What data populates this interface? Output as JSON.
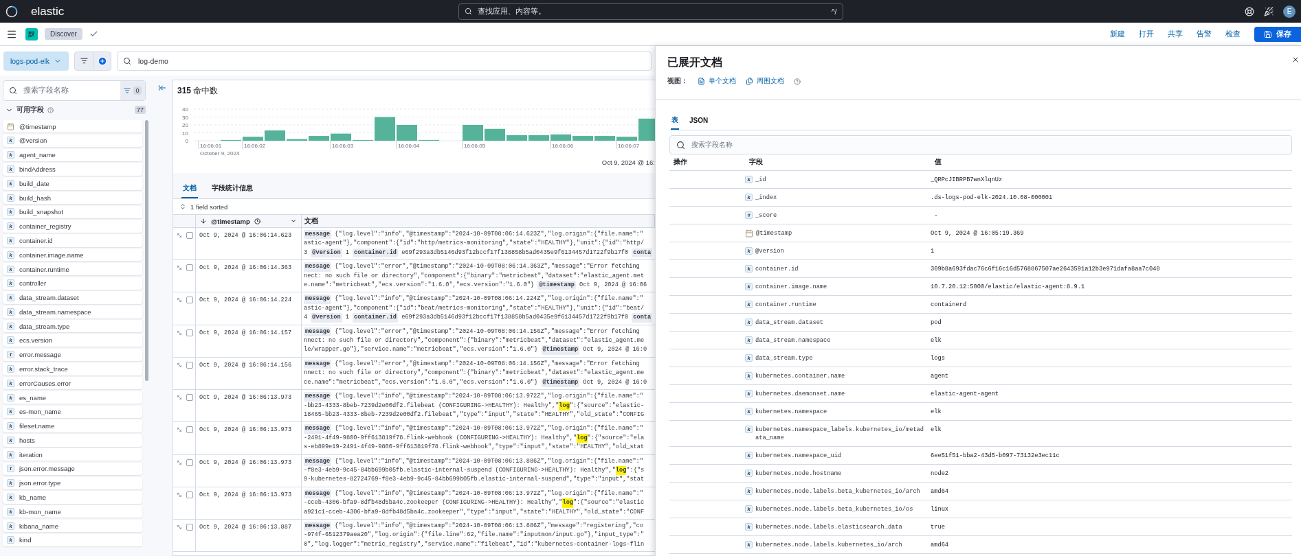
{
  "top_bar": {
    "brand": "elastic",
    "search": {
      "placeholder": "查找应用、内容等。",
      "shortcut": "^/"
    },
    "avatar": "E"
  },
  "nav_bar": {
    "space_badge": "默",
    "breadcrumb": "Discover",
    "actions": [
      "新建",
      "打开",
      "共享",
      "告警",
      "检查"
    ],
    "save": "保存"
  },
  "query_bar": {
    "data_view": "logs-pod-elk",
    "query": "log-demo"
  },
  "sidebar": {
    "search": {
      "placeholder": "搜索字段名称"
    },
    "filter_count": "0",
    "section": {
      "title": "可用字段",
      "count": "77",
      "expanded": true
    },
    "fields": [
      {
        "name": "@timestamp",
        "kind": "date"
      },
      {
        "name": "@version",
        "kind": "keyword",
        "badge": "k"
      },
      {
        "name": "agent_name",
        "kind": "keyword",
        "badge": "k"
      },
      {
        "name": "bindAddress",
        "kind": "keyword",
        "badge": "k"
      },
      {
        "name": "build_date",
        "kind": "keyword",
        "badge": "k"
      },
      {
        "name": "build_hash",
        "kind": "keyword",
        "badge": "k"
      },
      {
        "name": "build_snapshot",
        "kind": "keyword",
        "badge": "k"
      },
      {
        "name": "container_registry",
        "kind": "keyword",
        "badge": "k"
      },
      {
        "name": "container.id",
        "kind": "keyword",
        "badge": "k"
      },
      {
        "name": "container.image.name",
        "kind": "keyword",
        "badge": "k"
      },
      {
        "name": "container.runtime",
        "kind": "keyword",
        "badge": "k"
      },
      {
        "name": "controller",
        "kind": "keyword",
        "badge": "k"
      },
      {
        "name": "data_stream.dataset",
        "kind": "keyword",
        "badge": "k"
      },
      {
        "name": "data_stream.namespace",
        "kind": "keyword",
        "badge": "k"
      },
      {
        "name": "data_stream.type",
        "kind": "keyword",
        "badge": "k"
      },
      {
        "name": "ecs.version",
        "kind": "keyword",
        "badge": "k"
      },
      {
        "name": "error.message",
        "kind": "text",
        "badge": "t"
      },
      {
        "name": "error.stack_trace",
        "kind": "keyword",
        "badge": "k"
      },
      {
        "name": "errorCauses.error",
        "kind": "keyword",
        "badge": "k"
      },
      {
        "name": "es_name",
        "kind": "keyword",
        "badge": "k"
      },
      {
        "name": "es-mon_name",
        "kind": "keyword",
        "badge": "k"
      },
      {
        "name": "fileset.name",
        "kind": "keyword",
        "badge": "k"
      },
      {
        "name": "hosts",
        "kind": "keyword",
        "badge": "k"
      },
      {
        "name": "iteration",
        "kind": "keyword",
        "badge": "k"
      },
      {
        "name": "json.error.message",
        "kind": "text",
        "badge": "t"
      },
      {
        "name": "json.error.type",
        "kind": "keyword",
        "badge": "k"
      },
      {
        "name": "kb_name",
        "kind": "keyword",
        "badge": "k"
      },
      {
        "name": "kb-mon_name",
        "kind": "keyword",
        "badge": "k"
      },
      {
        "name": "kibana_name",
        "kind": "keyword",
        "badge": "k"
      },
      {
        "name": "kind",
        "kind": "keyword",
        "badge": "k"
      }
    ]
  },
  "hits": {
    "title": "**315** 命中数"
  },
  "histogram": {
    "time_range": "Oct 9, 2024 @ 16:",
    "chart_data": {
      "type": "bar",
      "xlabel": "October 9, 2024",
      "grid": true,
      "categories": [
        "16:06:01",
        null,
        "16:06:02",
        null,
        null,
        null,
        "16:06:03",
        null,
        null,
        "16:06:04",
        null,
        null,
        "16:06:05",
        null,
        null,
        null,
        "16:06:06",
        null,
        null,
        "16:06:07",
        null
      ],
      "values": [
        0,
        1,
        5,
        13,
        2,
        6,
        9,
        1,
        30,
        20,
        1,
        0,
        20,
        15,
        7,
        7,
        8,
        6,
        6,
        5,
        28
      ],
      "ylim": [
        0,
        40
      ],
      "yticks": [
        0,
        10,
        20,
        30,
        40
      ]
    }
  },
  "tabs": [
    {
      "label": "文档",
      "selected": true
    },
    {
      "label": "字段统计信息",
      "selected": false
    }
  ],
  "sort_info": "1 field sorted",
  "table": {
    "columns": [
      "@timestamp",
      "文档"
    ],
    "rows": [
      {
        "timestamp": "Oct 9, 2024 @ 16:06:14.623",
        "checked": false,
        "lines": [
          [
            {
              "kind": "chip",
              "text": "message"
            },
            {
              "kind": "text",
              "text": " {\"log.level\":\"info\",\"@timestamp\":\"2024-10-09T08:06:14.623Z\",\"log.origin\":{\"file.name\":\""
            }
          ],
          [
            {
              "kind": "text",
              "text": "astic-agent\"},\"component\":{\"id\":\"http/metrics-monitoring\",\"state\":\"HEALTHY\"},\"unit\":{\"id\":\"http/"
            }
          ],
          [
            {
              "kind": "text",
              "text": "3 "
            },
            {
              "kind": "chip",
              "text": "@version"
            },
            {
              "kind": "text",
              "text": " 1 "
            },
            {
              "kind": "chip",
              "text": "container.id"
            },
            {
              "kind": "text",
              "text": " e69f293a3db5146d93f12bccf17f138858b5ad0435e9f6134457d1722f9b17f0 "
            },
            {
              "kind": "chip",
              "text": "conta"
            }
          ]
        ]
      },
      {
        "timestamp": "Oct 9, 2024 @ 16:06:14.363",
        "checked": false,
        "lines": [
          [
            {
              "kind": "chip",
              "text": "message"
            },
            {
              "kind": "text",
              "text": " {\"log.level\":\"error\",\"@timestamp\":\"2024-10-09T08:06:14.363Z\",\"message\":\"Error fetching"
            }
          ],
          [
            {
              "kind": "text",
              "text": "nect: no such file or directory\",\"component\":{\"binary\":\"metricbeat\",\"dataset\":\"elastic_agent.met"
            }
          ],
          [
            {
              "kind": "text",
              "text": "e.name\":\"metricbeat\",\"ecs.version\":\"1.6.0\",\"ecs.version\":\"1.6.0\"} "
            },
            {
              "kind": "chip",
              "text": "@timestamp"
            },
            {
              "kind": "text",
              "text": " Oct 9, 2024 @ 16:06"
            }
          ]
        ]
      },
      {
        "timestamp": "Oct 9, 2024 @ 16:06:14.224",
        "checked": false,
        "lines": [
          [
            {
              "kind": "chip",
              "text": "message"
            },
            {
              "kind": "text",
              "text": " {\"log.level\":\"info\",\"@timestamp\":\"2024-10-09T08:06:14.224Z\",\"log.origin\":{\"file.name\":\""
            }
          ],
          [
            {
              "kind": "text",
              "text": "astic-agent\"},\"component\":{\"id\":\"beat/metrics-monitoring\",\"state\":\"HEALTHY\"},\"unit\":{\"id\":\"beat/"
            }
          ],
          [
            {
              "kind": "text",
              "text": "4 "
            },
            {
              "kind": "chip",
              "text": "@version"
            },
            {
              "kind": "text",
              "text": " 1 "
            },
            {
              "kind": "chip",
              "text": "container.id"
            },
            {
              "kind": "text",
              "text": " e69f293a3db5146d93f12bccf17f138858b5ad0435e9f6134457d1722f9b17f0 "
            },
            {
              "kind": "chip",
              "text": "conta"
            }
          ]
        ]
      },
      {
        "timestamp": "Oct 9, 2024 @ 16:06:14.157",
        "checked": false,
        "lines": [
          [
            {
              "kind": "chip",
              "text": "message"
            },
            {
              "kind": "text",
              "text": " {\"log.level\":\"error\",\"@timestamp\":\"2024-10-09T08:06:14.156Z\",\"message\":\"Error fetching"
            }
          ],
          [
            {
              "kind": "text",
              "text": "nnect: no such file or directory\",\"component\":{\"binary\":\"metricbeat\",\"dataset\":\"elastic_agent.me"
            }
          ],
          [
            {
              "kind": "text",
              "text": "le/wrapper.go\"},\"service.name\":\"metricbeat\",\"ecs.version\":\"1.6.0\"} "
            },
            {
              "kind": "chip",
              "text": "@timestamp"
            },
            {
              "kind": "text",
              "text": " Oct 9, 2024 @ 16:0"
            }
          ]
        ]
      },
      {
        "timestamp": "Oct 9, 2024 @ 16:06:14.156",
        "checked": false,
        "lines": [
          [
            {
              "kind": "chip",
              "text": "message"
            },
            {
              "kind": "text",
              "text": " {\"log.level\":\"error\",\"@timestamp\":\"2024-10-09T08:06:14.156Z\",\"message\":\"Error fetching"
            }
          ],
          [
            {
              "kind": "text",
              "text": "nnect: no such file or directory\",\"component\":{\"binary\":\"metricbeat\",\"dataset\":\"elastic_agent.me"
            }
          ],
          [
            {
              "kind": "text",
              "text": "ce.name\":\"metricbeat\",\"ecs.version\":\"1.6.0\",\"ecs.version\":\"1.6.0\"} "
            },
            {
              "kind": "chip",
              "text": "@timestamp"
            },
            {
              "kind": "text",
              "text": " Oct 9, 2024 @ 16:0"
            }
          ]
        ]
      },
      {
        "timestamp": "Oct 9, 2024 @ 16:06:13.973",
        "checked": false,
        "lines": [
          [
            {
              "kind": "chip",
              "text": "message"
            },
            {
              "kind": "text",
              "text": " {\"log.level\":\"info\",\"@timestamp\":\"2024-10-09T08:06:13.972Z\",\"log.origin\":{\"file.name\":\""
            }
          ],
          [
            {
              "kind": "text",
              "text": "-bb23-4333-8beb-7239d2e00df2.filebeat (CONFIGURING->HEALTHY): Healthy\",\""
            },
            {
              "kind": "mark",
              "text": "log"
            },
            {
              "kind": "text",
              "text": "\":{\"source\":\"elastic-"
            }
          ],
          [
            {
              "kind": "text",
              "text": "18465-bb23-4333-8beb-7239d2e00df2.filebeat\",\"type\":\"input\",\"state\":\"HEALTHY\",\"old_state\":\"CONFIG"
            }
          ]
        ]
      },
      {
        "timestamp": "Oct 9, 2024 @ 16:06:13.973",
        "checked": false,
        "lines": [
          [
            {
              "kind": "chip",
              "text": "message"
            },
            {
              "kind": "text",
              "text": " {\"log.level\":\"info\",\"@timestamp\":\"2024-10-09T08:06:13.972Z\",\"log.origin\":{\"file.name\":\""
            }
          ],
          [
            {
              "kind": "text",
              "text": "-2491-4f49-9800-9ff613819f78.flink-webhook (CONFIGURING->HEALTHY): Healthy\",\""
            },
            {
              "kind": "mark",
              "text": "log"
            },
            {
              "kind": "text",
              "text": "\":{\"source\":\"ela"
            }
          ],
          [
            {
              "kind": "text",
              "text": "s-eb899e19-2491-4f49-9800-9ff613819f78.flink-webhook\",\"type\":\"input\",\"state\":\"HEALTHY\",\"old_stat"
            }
          ]
        ]
      },
      {
        "timestamp": "Oct 9, 2024 @ 16:06:13.973",
        "checked": false,
        "lines": [
          [
            {
              "kind": "chip",
              "text": "message"
            },
            {
              "kind": "text",
              "text": " {\"log.level\":\"info\",\"@timestamp\":\"2024-10-09T08:06:13.886Z\",\"log.origin\":{\"file.name\":\""
            }
          ],
          [
            {
              "kind": "text",
              "text": "-f8e3-4eb9-9c45-84bb699b05fb.elastic-internal-suspend (CONFIGURING->HEALTHY): Healthy\",\""
            },
            {
              "kind": "mark",
              "text": "log"
            },
            {
              "kind": "text",
              "text": "\":{\"s"
            }
          ],
          [
            {
              "kind": "text",
              "text": "9-kubernetes-82724769-f8e3-4eb9-9c45-84bb699b05fb.elastic-internal-suspend\",\"type\":\"input\",\"stat"
            }
          ]
        ]
      },
      {
        "timestamp": "Oct 9, 2024 @ 16:06:13.973",
        "checked": false,
        "lines": [
          [
            {
              "kind": "chip",
              "text": "message"
            },
            {
              "kind": "text",
              "text": " {\"log.level\":\"info\",\"@timestamp\":\"2024-10-09T08:06:13.972Z\",\"log.origin\":{\"file.name\":\""
            }
          ],
          [
            {
              "kind": "text",
              "text": "-cceb-4306-bfa9-8dfb48d5ba4c.zookeeper (CONFIGURING->HEALTHY): Healthy\",\""
            },
            {
              "kind": "mark",
              "text": "log"
            },
            {
              "kind": "text",
              "text": "\":{\"source\":\"elastic"
            }
          ],
          [
            {
              "kind": "text",
              "text": "a921c1-cceb-4306-bfa9-8dfb48d5ba4c.zookeeper\",\"type\":\"input\",\"state\":\"HEALTHY\",\"old_state\":\"CONF"
            }
          ]
        ]
      },
      {
        "timestamp": "Oct 9, 2024 @ 16:06:13.887",
        "checked": false,
        "lines": [
          [
            {
              "kind": "chip",
              "text": "message"
            },
            {
              "kind": "text",
              "text": " {\"log.level\":\"info\",\"@timestamp\":\"2024-10-09T08:06:13.886Z\",\"message\":\"registering\",\"co"
            }
          ],
          [
            {
              "kind": "text",
              "text": "-974f-6512379aea20\",\"log.origin\":{\"file.line\":62,\"file.name\":\"inputmon/input.go\"},\"input_type\":\""
            }
          ],
          [
            {
              "kind": "text",
              "text": "0\",\"log.logger\":\"metric_registry\",\"service.name\":\"filebeat\",\"id\":\"kubernetes-container-logs-flin"
            }
          ]
        ]
      }
    ]
  },
  "flyout": {
    "title": "已展开文档",
    "view_label": "视图：",
    "views": [
      {
        "kind": "single",
        "label": "单个文档"
      },
      {
        "kind": "surrounding",
        "label": "周围文档"
      }
    ],
    "tabs": [
      {
        "label": "表",
        "selected": true
      },
      {
        "label": "JSON",
        "selected": false
      }
    ],
    "search": {
      "placeholder": "搜索字段名称"
    },
    "columns": [
      "操作",
      "字段",
      "值"
    ],
    "rows": [
      {
        "field": "_id",
        "kind": "keyword",
        "badge": "k",
        "value": "_QRPcJIBRPB7wnXlqnUz"
      },
      {
        "field": "_index",
        "kind": "keyword",
        "badge": "k",
        "value": ".ds-logs-pod-elk-2024.10.08-000001"
      },
      {
        "field": "_score",
        "kind": "number",
        "badge": "#",
        "value": " -"
      },
      {
        "field": "@timestamp",
        "kind": "date",
        "value": "Oct 9, 2024 @ 16:05:19.369"
      },
      {
        "field": "@version",
        "kind": "keyword",
        "badge": "k",
        "value": "1"
      },
      {
        "field": "container.id",
        "kind": "keyword",
        "badge": "k",
        "value": "309b8a693fdac76c6f16c16d5768867507ae2643591a12b3e971dafa8aa7c048"
      },
      {
        "field": "container.image.name",
        "kind": "keyword",
        "badge": "k",
        "value": "10.7.20.12:5000/elastic/elastic-agent:8.9.1"
      },
      {
        "field": "container.runtime",
        "kind": "keyword",
        "badge": "k",
        "value": "containerd"
      },
      {
        "field": "data_stream.dataset",
        "kind": "keyword",
        "badge": "k",
        "value": "pod"
      },
      {
        "field": "data_stream.namespace",
        "kind": "keyword",
        "badge": "k",
        "value": "elk"
      },
      {
        "field": "data_stream.type",
        "kind": "keyword",
        "badge": "k",
        "value": "logs"
      },
      {
        "field": "kubernetes.container.name",
        "kind": "keyword",
        "badge": "k",
        "value": "agent"
      },
      {
        "field": "kubernetes.daemonset.name",
        "kind": "keyword",
        "badge": "k",
        "value": "elastic-agent-agent"
      },
      {
        "field": "kubernetes.namespace",
        "kind": "keyword",
        "badge": "k",
        "value": "elk"
      },
      {
        "field": "kubernetes.namespace_labels.kubernetes_io/metadata_name",
        "kind": "keyword",
        "badge": "k",
        "value": "elk"
      },
      {
        "field": "kubernetes.namespace_uid",
        "kind": "keyword",
        "badge": "k",
        "value": "6ee51f51-bba2-43d5-b097-73132e3ec11c"
      },
      {
        "field": "kubernetes.node.hostname",
        "kind": "keyword",
        "badge": "k",
        "value": "node2"
      },
      {
        "field": "kubernetes.node.labels.beta_kubernetes_io/arch",
        "kind": "keyword",
        "badge": "k",
        "value": "amd64"
      },
      {
        "field": "kubernetes.node.labels.beta_kubernetes_io/os",
        "kind": "keyword",
        "badge": "k",
        "value": "linux"
      },
      {
        "field": "kubernetes.node.labels.elasticsearch_data",
        "kind": "keyword",
        "badge": "k",
        "value": "true"
      },
      {
        "field": "kubernetes.node.labels.kubernetes_io/arch",
        "kind": "keyword",
        "badge": "k",
        "value": "amd64"
      }
    ]
  }
}
